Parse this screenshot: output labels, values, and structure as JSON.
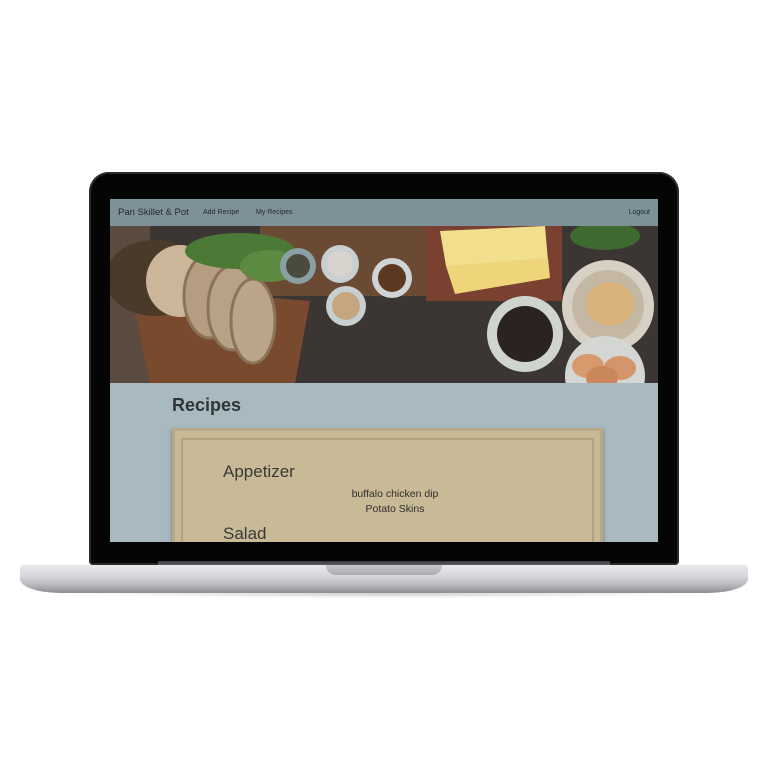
{
  "navbar": {
    "brand": "Pan Skillet & Pot",
    "links": [
      "Add Recipe",
      "My Recipes"
    ],
    "logout": "Logout"
  },
  "hero": {
    "image_description_icon": "food-hero-image"
  },
  "main": {
    "title": "Recipes",
    "categories": [
      {
        "name": "Appetizer",
        "recipes": [
          "buffalo chicken dip",
          "Potato Skins"
        ]
      },
      {
        "name": "Salad",
        "recipes": []
      }
    ]
  },
  "colors": {
    "screen_bg": "#a8b9c0",
    "navbar_bg": "#7e9199",
    "card_bg": "#c8b997"
  }
}
